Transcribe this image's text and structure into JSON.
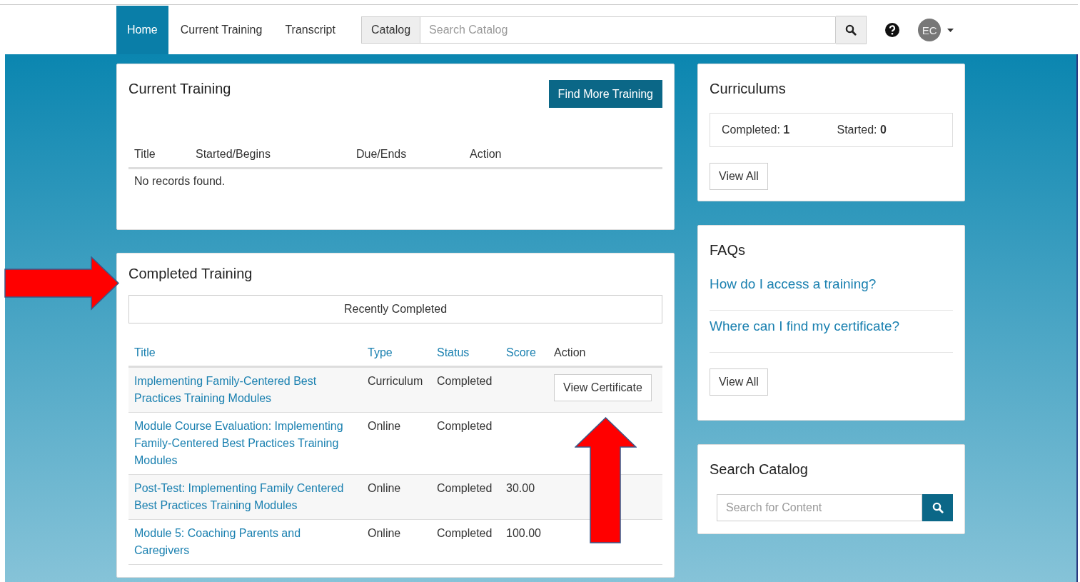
{
  "nav": {
    "tabs": [
      {
        "label": "Home",
        "selected": true
      },
      {
        "label": "Current Training",
        "selected": false
      },
      {
        "label": "Transcript",
        "selected": false
      }
    ],
    "catalog_button": "Catalog",
    "search": {
      "placeholder": "Search Catalog"
    },
    "avatar": "EC"
  },
  "current_training": {
    "title": "Current Training",
    "button": "Find More Training",
    "columns": [
      "Title",
      "Started/Begins",
      "Due/Ends",
      "Action"
    ],
    "empty": "No records found."
  },
  "completed_training": {
    "title": "Completed Training",
    "filter": "Recently Completed",
    "columns": [
      {
        "label": "Title",
        "sortable": true
      },
      {
        "label": "Type",
        "sortable": true
      },
      {
        "label": "Status",
        "sortable": true
      },
      {
        "label": "Score",
        "sortable": true
      },
      {
        "label": "Action",
        "sortable": false
      }
    ],
    "rows": [
      {
        "title": "Implementing Family-Centered Best Practices Training Modules",
        "type": "Curriculum",
        "status": "Completed",
        "score": "",
        "action": "View Certificate"
      },
      {
        "title": "Module Course Evaluation: Implementing Family-Centered Best Practices Training Modules",
        "type": "Online",
        "status": "Completed",
        "score": "",
        "action": ""
      },
      {
        "title": "Post-Test: Implementing Family Centered Best Practices Training Modules",
        "type": "Online",
        "status": "Completed",
        "score": "30.00",
        "action": ""
      },
      {
        "title": "Module 5: Coaching Parents and Caregivers",
        "type": "Online",
        "status": "Completed",
        "score": "100.00",
        "action": ""
      }
    ]
  },
  "curriculums": {
    "title": "Curriculums",
    "stats": [
      {
        "label": "Completed:",
        "value": "1"
      },
      {
        "label": "Started:",
        "value": "0"
      }
    ],
    "button": "View All"
  },
  "faqs": {
    "title": "FAQs",
    "links": [
      "How do I access a training?",
      "Where can I find my certificate?"
    ],
    "button": "View All"
  },
  "search_catalog": {
    "title": "Search Catalog",
    "placeholder": "Search for Content"
  },
  "annotations": [
    {
      "kind": "arrow-right"
    },
    {
      "kind": "arrow-up"
    }
  ]
}
